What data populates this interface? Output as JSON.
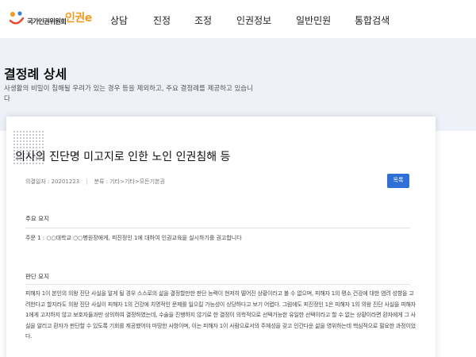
{
  "header": {
    "logo_sub": "국가인권위원회",
    "logo_main": "인권e",
    "nav": [
      "상담",
      "진정",
      "조정",
      "인권정보",
      "일반민원",
      "통합검색"
    ]
  },
  "banner": {
    "title": "결정례 상세",
    "description": "사생활의 비밀이 침해될 우려가 있는 경우 등을 제외하고, 주요 결정례를 제공하고 있습니다"
  },
  "detail": {
    "title": "의사의 진단명 미고지로 인한 노인 인권침해 등",
    "decision_date": "의결일자 : 20201223",
    "category": "분류 : 기타>기타>모든기본권",
    "list_button": "목록",
    "main_label": "주요 요지",
    "main_text": "주문 1 : ○○대학교 ○○병원장에게, 피진정인 1에 대하여 인권교육을 실시하기를 권고합니다",
    "judgment_label": "판단 요지",
    "judgment_text": "피해자 1이 본인의 의왕 진단 사실을 알게 될 경우 스스로의 삶을 결정할만한 판단 능력이 현저히 떨어진 상황이라고 볼 수 없으며, 피해자 1의 평소 건강에 대한 염려 성향을 고려한다고 할지라도 의왕 진단 사실이 피해자 1의 건강에 치명적인 문제를 일으킬 가능성이 상당하다고 보기 어렵다. 그럼에도 피진정인 1은 피해자 1의 의왕 진단 사실을 피해자 1에게 고지하지 않고 보호자들과만 상의하여 결정하였는데, 수술을 진행하지 않기로 한 결정이 의학적으로 선택가능한 유일한 선택이라고 할 수 없는 상황이라면 환자에게 그 사실을 알리고 환자가 판단할 수 있도록 기회를 제공했어야 마땅한 사항이며, 이는 피해자 1이 사람으로서의 주체성을 갖고 인간다운 삶을 영위하는데 핵심적으로 필요한 과정이었다."
  }
}
